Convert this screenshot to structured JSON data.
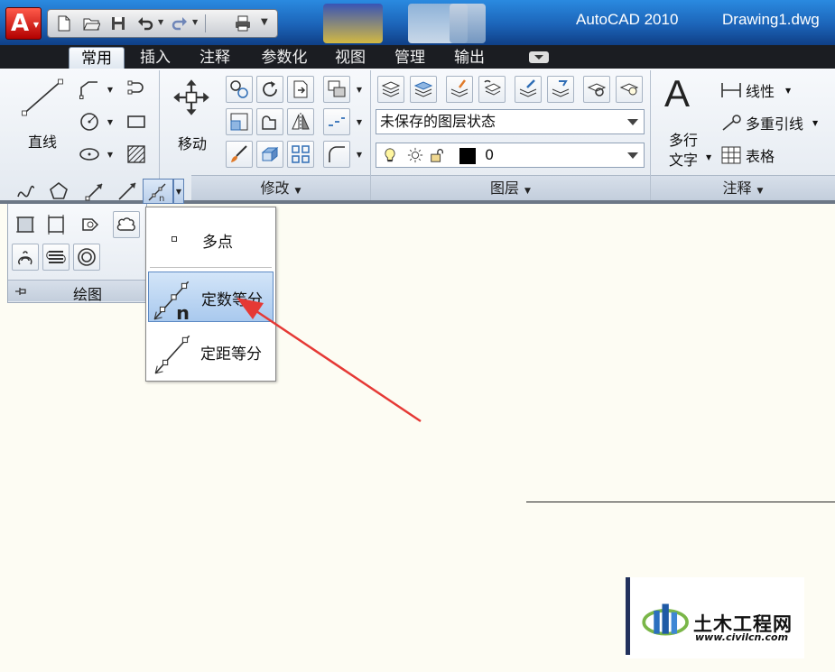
{
  "titlebar": {
    "app_name": "AutoCAD 2010",
    "document_name": "Drawing1.dwg"
  },
  "tabs": [
    {
      "label": "常用",
      "active": true
    },
    {
      "label": "插入",
      "active": false
    },
    {
      "label": "注释",
      "active": false
    },
    {
      "label": "参数化",
      "active": false
    },
    {
      "label": "视图",
      "active": false
    },
    {
      "label": "管理",
      "active": false
    },
    {
      "label": "输出",
      "active": false
    }
  ],
  "ribbon": {
    "draw": {
      "line_label": "直线",
      "panel_title": "绘图"
    },
    "modify": {
      "move_label": "移动",
      "panel_title": "修改"
    },
    "layers": {
      "layer_state": "未保存的图层状态",
      "current_layer": "0",
      "panel_title": "图层"
    },
    "annotation": {
      "mtext_label_line1": "多行",
      "mtext_label_line2": "文字",
      "linear_label": "线性",
      "multileader_label": "多重引线",
      "table_label": "表格",
      "panel_title": "注释"
    }
  },
  "flyout": {
    "items": [
      {
        "label": "多点",
        "selected": false
      },
      {
        "label": "定数等分",
        "selected": true
      },
      {
        "label": "定距等分",
        "selected": false
      }
    ]
  },
  "watermark": {
    "text": "土木工程网",
    "url": "www.civilcn.com"
  },
  "colors": {
    "accent": "#1c64b8",
    "annotation_arrow": "#e53935",
    "drawing_background": "#fdfcf3"
  }
}
